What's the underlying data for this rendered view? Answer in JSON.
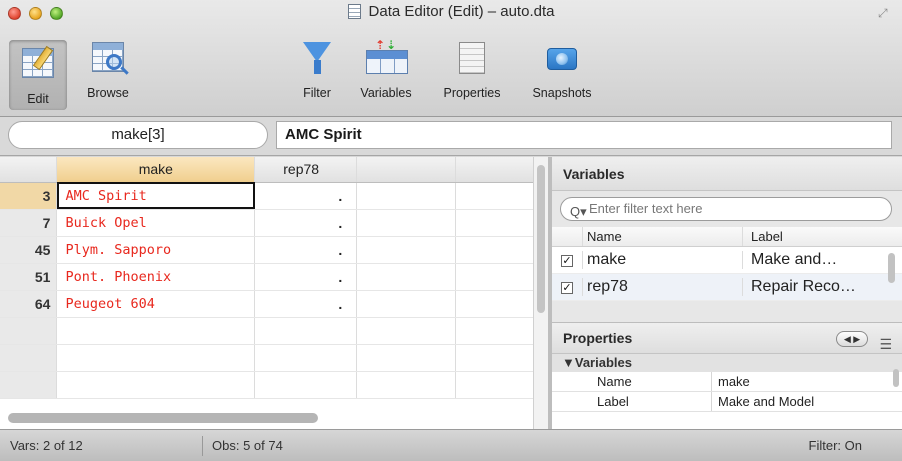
{
  "window": {
    "title": "Data Editor (Edit) – auto.dta"
  },
  "toolbar": {
    "edit_label": "Edit",
    "browse_label": "Browse",
    "filter_label": "Filter",
    "variables_label": "Variables",
    "properties_label": "Properties",
    "snapshots_label": "Snapshots"
  },
  "cell_editor": {
    "reference": "make[3]",
    "value": "AMC Spirit"
  },
  "grid": {
    "headers": {
      "make": "make",
      "rep78": "rep78"
    },
    "rows": [
      {
        "obs": "3",
        "make": "AMC Spirit",
        "rep78": "."
      },
      {
        "obs": "7",
        "make": "Buick Opel",
        "rep78": "."
      },
      {
        "obs": "45",
        "make": "Plym. Sapporo",
        "rep78": "."
      },
      {
        "obs": "51",
        "make": "Pont. Phoenix",
        "rep78": "."
      },
      {
        "obs": "64",
        "make": "Peugeot 604",
        "rep78": "."
      }
    ]
  },
  "variables_panel": {
    "title": "Variables",
    "filter_placeholder": "Enter filter text here",
    "col_name": "Name",
    "col_label": "Label",
    "items": [
      {
        "name": "make",
        "label": "Make and…",
        "checked": true
      },
      {
        "name": "rep78",
        "label": "Repair Reco…",
        "checked": true
      }
    ]
  },
  "properties_panel": {
    "title": "Properties",
    "section": "▼Variables",
    "rows": [
      {
        "key": "Name",
        "value": "make"
      },
      {
        "key": "Label",
        "value": "Make and Model"
      }
    ]
  },
  "status": {
    "vars": "Vars: 2 of 12",
    "obs": "Obs: 5 of 74",
    "filter": "Filter: On"
  }
}
